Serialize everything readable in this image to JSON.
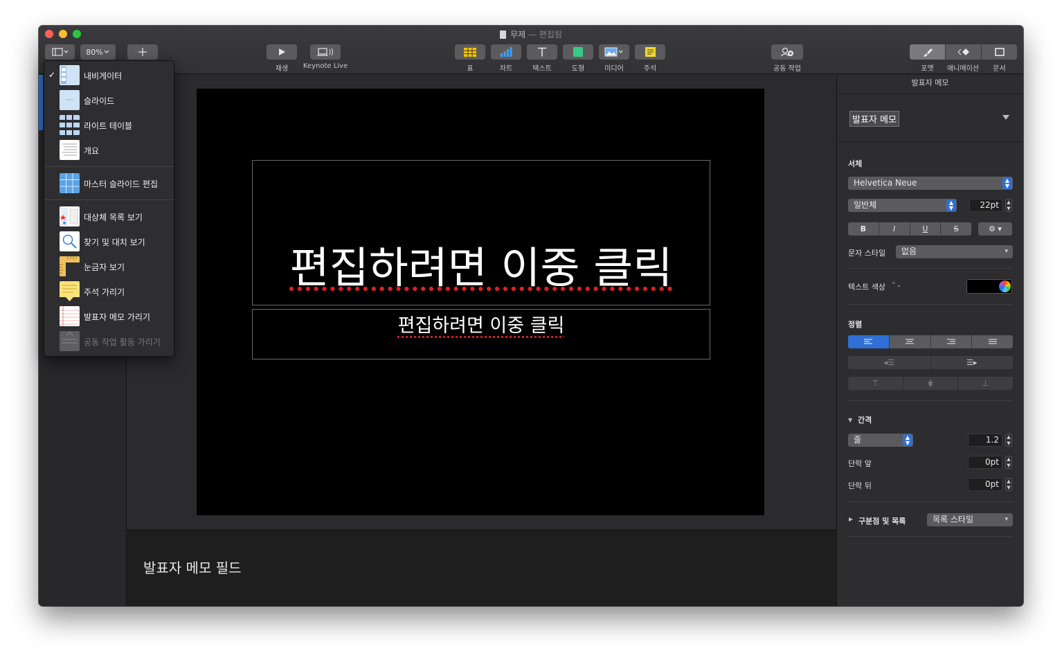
{
  "window": {
    "title": "무제",
    "title_suffix": "— 편집됨",
    "colors": {
      "close": "#fe5f57",
      "minimize": "#febc2e",
      "maximize": "#28c840",
      "accent": "#2f6fd6"
    }
  },
  "toolbar": {
    "zoom": "80%",
    "play_label": "재생",
    "keynote_live_label": "Keynote Live",
    "table_label": "표",
    "chart_label": "차트",
    "text_label": "텍스트",
    "shape_label": "도형",
    "media_label": "미디어",
    "comment_label": "주석",
    "collab_label": "공동 작업",
    "format_label": "포맷",
    "animate_label": "애니메이션",
    "document_label": "문서"
  },
  "view_menu": {
    "items": [
      {
        "label": "내비게이터",
        "checked": true
      },
      {
        "label": "슬라이드"
      },
      {
        "label": "라이트 테이블"
      },
      {
        "label": "개요"
      },
      {
        "label": "마스터 슬라이드 편집"
      },
      {
        "label": "대상체 목록 보기"
      },
      {
        "label": "찾기 및 대치 보기"
      },
      {
        "label": "눈금자 보기"
      },
      {
        "label": "주석 가리기"
      },
      {
        "label": "발표자 메모 가리기"
      },
      {
        "label": "공동 작업 활동 가리기",
        "disabled": true
      }
    ],
    "check_mark": "✓"
  },
  "slide": {
    "title_placeholder": "편집하려면 이중 클릭",
    "subtitle_placeholder": "편집하려면 이중 클릭"
  },
  "notes": {
    "text": "발표자 메모 필드"
  },
  "inspector": {
    "header": "발표자 메모",
    "paragraph_style": "발표자 메모",
    "font_section": "서체",
    "font_family": "Helvetica Neue",
    "font_weight": "일반체",
    "font_size": "22pt",
    "bold": "B",
    "italic": "I",
    "underline": "U",
    "strike": "S",
    "char_style_label": "문자 스타일",
    "char_style_value": "없음",
    "text_color_label": "텍스트 색상",
    "text_color": "#000000",
    "align_section": "정렬",
    "spacing_section": "간격",
    "line_mode": "줄",
    "line_value": "1.2",
    "before_label": "단락 앞",
    "before_value": "0pt",
    "after_label": "단락 뒤",
    "after_value": "0pt",
    "bullets_label": "구분점 및 목록",
    "bullets_value": "목록 스타일"
  }
}
